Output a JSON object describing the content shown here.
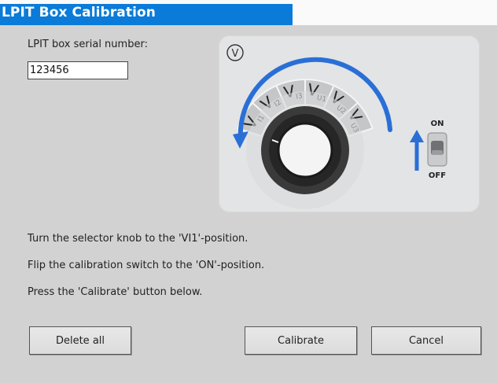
{
  "window": {
    "title": "LPIT Box Calibration"
  },
  "serial": {
    "label": "LPIT box serial number:",
    "value": "123456"
  },
  "panel": {
    "mode_glyph": "V",
    "positions": [
      {
        "main": "V",
        "sub": "I1"
      },
      {
        "main": "V",
        "sub": "I2"
      },
      {
        "main": "V",
        "sub": "I3"
      },
      {
        "main": "V",
        "sub": "U1"
      },
      {
        "main": "V",
        "sub": "U2"
      },
      {
        "main": "V",
        "sub": "U3"
      }
    ],
    "switch_on": "ON",
    "switch_off": "OFF",
    "accent_color": "#2a6fd6"
  },
  "instructions": [
    "Turn the selector knob to the 'VI1'-position.",
    "Flip the calibration switch to the 'ON'-position.",
    "Press the 'Calibrate' button below."
  ],
  "buttons": {
    "delete_all": "Delete all",
    "calibrate": "Calibrate",
    "cancel": "Cancel"
  }
}
